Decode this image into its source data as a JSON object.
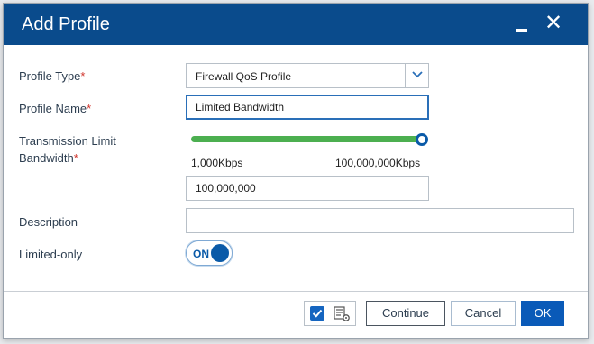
{
  "dialog": {
    "title": "Add Profile",
    "minimize_label": "_",
    "close_label": "✕"
  },
  "form": {
    "profile_type": {
      "label": "Profile Type",
      "required_mark": "*",
      "value": "Firewall QoS Profile"
    },
    "profile_name": {
      "label": "Profile Name",
      "required_mark": "*",
      "value": "Limited Bandwidth"
    },
    "transmission_limit": {
      "label_line1": "Transmission Limit",
      "label_line2": "Bandwidth",
      "required_mark": "*",
      "slider_min": "1,000Kbps",
      "slider_max": "100,000,000Kbps",
      "slider_fraction": 1.0,
      "value": "100,000,000"
    },
    "description": {
      "label": "Description",
      "value": ""
    },
    "limited_only": {
      "label": "Limited-only",
      "toggle_text": "ON",
      "state": true
    }
  },
  "footer": {
    "icons": [
      "checkbox-checked-icon",
      "list-settings-icon"
    ],
    "continue_label": "Continue",
    "cancel_label": "Cancel",
    "ok_label": "OK"
  },
  "colors": {
    "titlebar": "#0a4b8c",
    "accent": "#0a5ab8",
    "slider_fill": "#4caf50",
    "required": "#d0342c"
  }
}
